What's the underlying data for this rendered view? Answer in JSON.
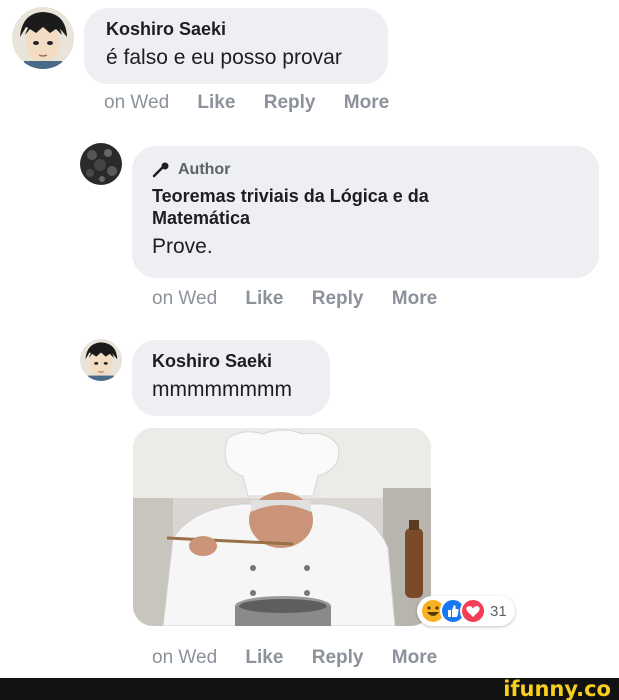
{
  "comments": [
    {
      "name": "Koshiro Saeki",
      "text": "é falso e eu posso provar",
      "time": "on Wed",
      "like": "Like",
      "reply": "Reply",
      "more": "More"
    },
    {
      "badge": "Author",
      "name": "Teoremas triviais da Lógica e da Matemática",
      "text": "Prove.",
      "time": "on Wed",
      "like": "Like",
      "reply": "Reply",
      "more": "More"
    },
    {
      "name": "Koshiro Saeki",
      "text": "mmmmmmmm",
      "time": "on Wed",
      "like": "Like",
      "reply": "Reply",
      "more": "More",
      "reaction_count": "31"
    }
  ],
  "reaction_icons": [
    "haha-icon",
    "like-icon",
    "love-icon"
  ],
  "colors": {
    "bubble": "#eeeff3",
    "action_text": "#8c929b",
    "like_blue": "#1877f2",
    "love_red": "#f33e58",
    "haha_yellow": "#f7b125",
    "watermark": "#f6cf1d"
  },
  "watermark": "ifunny.co"
}
